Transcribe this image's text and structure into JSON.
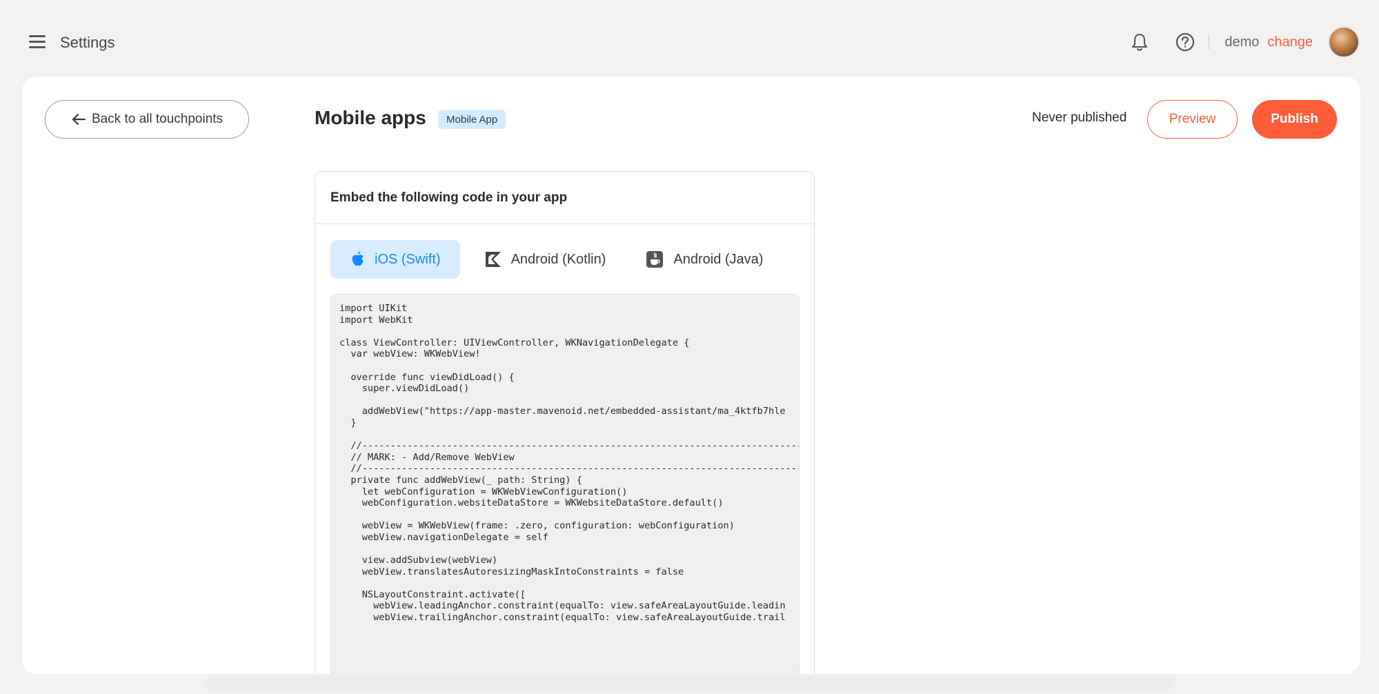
{
  "header": {
    "title": "Settings",
    "menu_icon": "hamburger-menu-icon",
    "notifications_icon": "bell-icon",
    "help_icon": "help-circle-icon",
    "user": {
      "name": "demo",
      "change_label": "change"
    }
  },
  "page": {
    "back_label": "Back to all touchpoints",
    "title": "Mobile apps",
    "badge": "Mobile App",
    "publish_status": "Never published",
    "preview_label": "Preview",
    "publish_label": "Publish"
  },
  "embed": {
    "heading": "Embed the following code in your app",
    "tabs": [
      {
        "label": "iOS (Swift)",
        "icon": "apple-icon",
        "active": true
      },
      {
        "label": "Android (Kotlin)",
        "icon": "kotlin-icon",
        "active": false
      },
      {
        "label": "Android (Java)",
        "icon": "java-icon",
        "active": false
      }
    ],
    "code": "import UIKit\nimport WebKit\n\nclass ViewController: UIViewController, WKNavigationDelegate {\n  var webView: WKWebView!\n\n  override func viewDidLoad() {\n    super.viewDidLoad()\n\n    addWebView(\"https://app-master.mavenoid.net/embedded-assistant/ma_4ktfb7hle\n  }\n\n  //------------------------------------------------------------------------------\n  // MARK: - Add/Remove WebView\n  //------------------------------------------------------------------------------\n  private func addWebView(_ path: String) {\n    let webConfiguration = WKWebViewConfiguration()\n    webConfiguration.websiteDataStore = WKWebsiteDataStore.default()\n\n    webView = WKWebView(frame: .zero, configuration: webConfiguration)\n    webView.navigationDelegate = self\n\n    view.addSubview(webView)\n    webView.translatesAutoresizingMaskIntoConstraints = false\n\n    NSLayoutConstraint.activate([\n      webView.leadingAnchor.constraint(equalTo: view.safeAreaLayoutGuide.leadin\n      webView.trailingAnchor.constraint(equalTo: view.safeAreaLayoutGuide.trail"
  },
  "colors": {
    "accent": "#ff5d3a",
    "tab_active_bg": "#d9ecff",
    "tab_active_text": "#1389ff",
    "badge_bg": "#d6eaff"
  }
}
